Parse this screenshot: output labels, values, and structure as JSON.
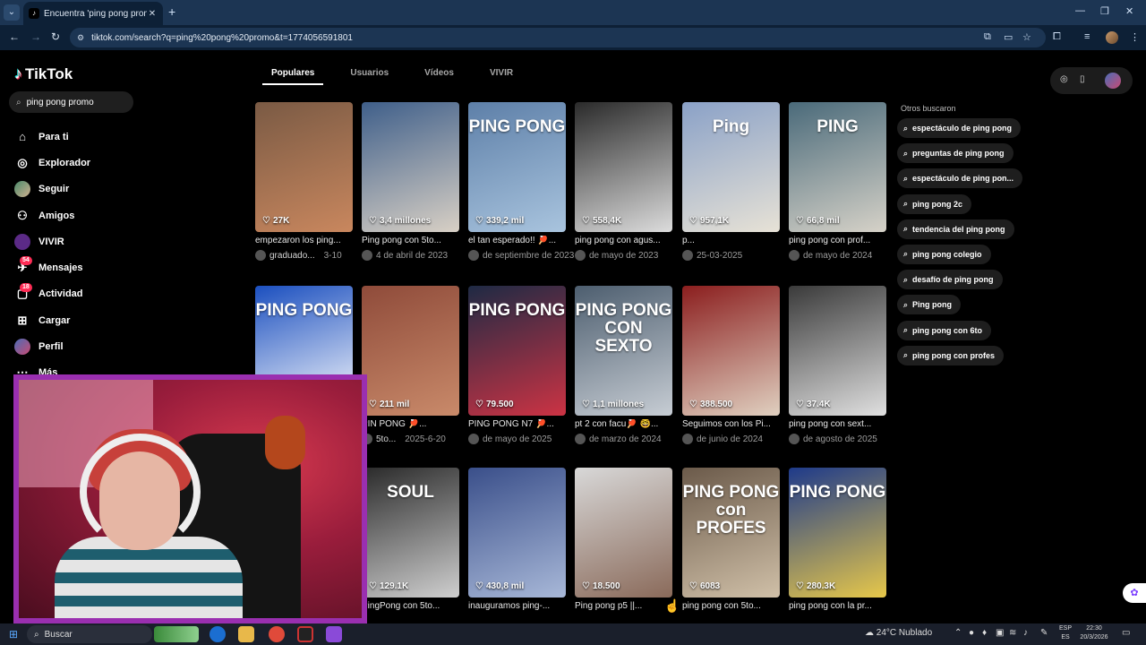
{
  "browser": {
    "tab_title": "Encuentra 'ping pong promo' e",
    "tab_favicon": "♪",
    "url": "tiktok.com/search?q=ping%20pong%20promo&t=1774056591801"
  },
  "sidebar": {
    "logo": "TikTok",
    "search_value": "ping pong promo",
    "items": [
      {
        "label": "Para ti",
        "icon": "home-icon"
      },
      {
        "label": "Explorador",
        "icon": "compass-icon"
      },
      {
        "label": "Seguir",
        "icon": "avatar"
      },
      {
        "label": "Amigos",
        "icon": "friends-icon"
      },
      {
        "label": "VIVIR",
        "icon": "live-icon"
      },
      {
        "label": "Mensajes",
        "icon": "messages-icon",
        "badge": "54"
      },
      {
        "label": "Actividad",
        "icon": "activity-icon",
        "badge": "18"
      },
      {
        "label": "Cargar",
        "icon": "upload-icon"
      },
      {
        "label": "Perfil",
        "icon": "profile-avatar"
      },
      {
        "label": "Más",
        "icon": "more-icon"
      }
    ]
  },
  "tabs": [
    "Populares",
    "Usuarios",
    "Vídeos",
    "VIVIR"
  ],
  "results": [
    {
      "likes": "27K",
      "caption": "empezaron los ping...",
      "user": "graduado...",
      "date": "3-10",
      "overlay": "",
      "colors": [
        "#7a5a44",
        "#c9875e"
      ]
    },
    {
      "likes": "3,4 millones",
      "caption": "Ping pong con 5to...",
      "user": "",
      "date": "4 de abril de 2023",
      "overlay": "",
      "colors": [
        "#3f5f8a",
        "#d8d0c5"
      ]
    },
    {
      "likes": "339,2 mil",
      "caption": "el tan esperado!! 🏓...",
      "user": "",
      "date": "de septiembre de 2023",
      "overlay": "PING PONG",
      "colors": [
        "#5d7fa8",
        "#a9c4de"
      ]
    },
    {
      "likes": "558,4K",
      "caption": "ping pong con agus...",
      "user": "",
      "date": "de mayo de 2023",
      "overlay": "",
      "colors": [
        "#2a2a2a",
        "#dcdcdc"
      ]
    },
    {
      "likes": "957,1K",
      "caption": "p...",
      "user": "",
      "date": "25-03-2025",
      "overlay": "Ping",
      "colors": [
        "#8aa1c7",
        "#e7e2d6"
      ]
    },
    {
      "likes": "66,8 mil",
      "caption": "ping pong con prof...",
      "user": "",
      "date": "de mayo de 2024",
      "overlay": "PING",
      "colors": [
        "#4a6a7a",
        "#d6d2c8"
      ]
    },
    {
      "likes": "",
      "caption": "",
      "user": "",
      "date": "",
      "overlay": "PING PONG",
      "colors": [
        "#1b4fbf",
        "#ffffff"
      ]
    },
    {
      "likes": "211 mil",
      "caption": "PIN PONG 🏓...",
      "user": "5to...",
      "date": "2025-6-20",
      "overlay": "",
      "colors": [
        "#8f4b3a",
        "#c98a6a"
      ]
    },
    {
      "likes": "79.500",
      "caption": "PING PONG N7 🏓...",
      "user": "",
      "date": "de mayo de 2025",
      "overlay": "PING PONG",
      "colors": [
        "#1e2a44",
        "#cc3344"
      ]
    },
    {
      "likes": "1,1 millones",
      "caption": "pt 2 con facu🏓 🤓...",
      "user": "",
      "date": "de marzo de 2024",
      "overlay": "PING PONG CON SEXTO",
      "colors": [
        "#4d5e6f",
        "#c7cdd4"
      ]
    },
    {
      "likes": "388.500",
      "caption": "Seguimos con los Pi...",
      "user": "",
      "date": "de junio de 2024",
      "overlay": "",
      "colors": [
        "#8b1e1e",
        "#e0d0c0"
      ]
    },
    {
      "likes": "37.4K",
      "caption": "ping pong con sext...",
      "user": "",
      "date": "de agosto de 2025",
      "overlay": "",
      "colors": [
        "#3a3a3a",
        "#e0e0e0"
      ]
    },
    {
      "likes": "",
      "caption": "",
      "user": "",
      "date": "",
      "overlay": "",
      "colors": [
        "#222",
        "#444"
      ]
    },
    {
      "likes": "129.1K",
      "caption": "PingPong con 5to...",
      "user": "",
      "date": "",
      "overlay": "SOUL",
      "colors": [
        "#2a2a2a",
        "#cfcfcf"
      ]
    },
    {
      "likes": "430,8 mil",
      "caption": "inauguramos ping-...",
      "user": "",
      "date": "",
      "overlay": "",
      "colors": [
        "#3a4f8a",
        "#a8b8d8"
      ]
    },
    {
      "likes": "18.500",
      "caption": "Ping pong p5 ||...",
      "user": "",
      "date": "",
      "overlay": "",
      "colors": [
        "#d8d8d8",
        "#8a6a5a"
      ]
    },
    {
      "likes": "6083",
      "caption": "ping pong con 5to...",
      "user": "",
      "date": "",
      "overlay": "PING PONG con PROFES",
      "colors": [
        "#6b5a4a",
        "#d0c0a8"
      ]
    },
    {
      "likes": "280.3K",
      "caption": "ping pong con la pr...",
      "user": "",
      "date": "",
      "overlay": "PING PONG",
      "colors": [
        "#1e3a8a",
        "#e7c84a"
      ]
    }
  ],
  "others": {
    "heading": "Otros buscaron",
    "items": [
      "espectáculo de ping pong",
      "preguntas de ping pong",
      "espectáculo de ping pon...",
      "ping pong 2c",
      "tendencia del ping pong",
      "ping pong colegio",
      "desafío de ping pong",
      "Ping pong",
      "ping pong con 6to",
      "ping pong con profes"
    ]
  },
  "taskbar": {
    "search": "Buscar",
    "weather": "24°C  Nublado",
    "lang_top": "ESP",
    "lang_bottom": "ES",
    "time": "22:30",
    "date": "20/3/2026"
  }
}
